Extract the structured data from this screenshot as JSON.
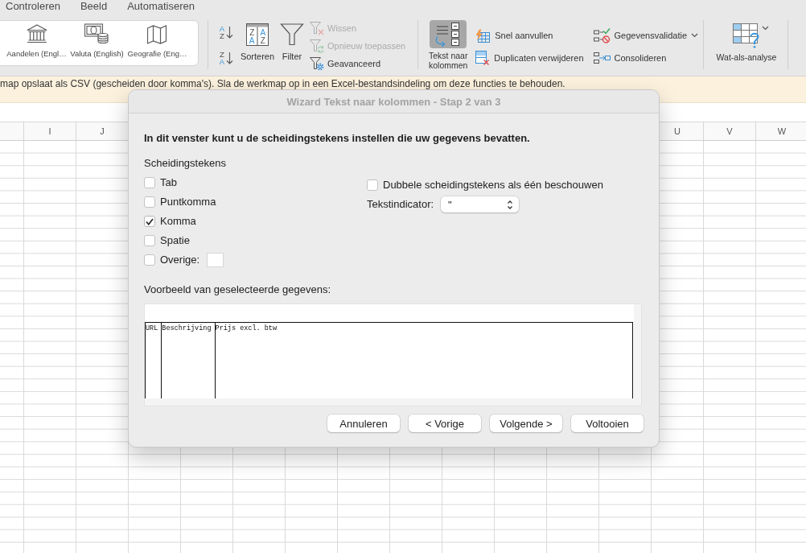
{
  "menu_tabs": [
    "Controleren",
    "Beeld",
    "Automatiseren"
  ],
  "ribbon": {
    "data_types": [
      {
        "kind": "stocks",
        "label": "Aandelen (Engl…"
      },
      {
        "kind": "currencies",
        "label": "Valuta (English)"
      },
      {
        "kind": "geography",
        "label": "Geografie (Eng…"
      }
    ],
    "sort_filter": {
      "quick_sort": [
        {
          "kind": "ascending",
          "letters": [
            "A",
            "Z"
          ]
        },
        {
          "kind": "descending",
          "letters": [
            "Z",
            "A"
          ]
        }
      ],
      "sort": {
        "label": "Sorteren",
        "letters": [
          "Z",
          "A",
          "A",
          "Z"
        ]
      },
      "filter": {
        "label": "Filter"
      },
      "filter_actions": [
        {
          "kind": "clear",
          "label": "Wissen",
          "disabled": true
        },
        {
          "kind": "reapply",
          "label": "Opnieuw toepassen",
          "disabled": true
        },
        {
          "kind": "advanced",
          "label": "Geavanceerd",
          "disabled": false
        }
      ]
    },
    "data_tools": {
      "text_to_columns": {
        "label": "Tekst naar kolommen",
        "selected": true
      },
      "actions": [
        {
          "kind": "flash_fill",
          "label": "Snel aanvullen",
          "dropdown": false
        },
        {
          "kind": "remove_duplicates",
          "label": "Duplicaten verwijderen",
          "dropdown": false
        },
        {
          "kind": "data_validation",
          "label": "Gegevensvalidatie",
          "dropdown": true
        },
        {
          "kind": "consolidate",
          "label": "Consolideren",
          "dropdown": false
        }
      ]
    },
    "what_if": {
      "label": "Wat-als-analyse",
      "dropdown": true
    }
  },
  "notice": {
    "text": "map opslaat als CSV (gescheiden door komma's). Sla de werkmap op in een Excel-bestandsindeling om deze functies te behouden."
  },
  "sheet": {
    "column_headers_left": [
      "I",
      "J"
    ],
    "column_headers_right": [
      "U",
      "V",
      "W"
    ]
  },
  "dialog": {
    "title": "Wizard Tekst naar kolommen - Stap 2 van 3",
    "instruction": "In dit venster kunt u de scheidingstekens instellen die uw gegevens bevatten.",
    "delimiters": {
      "heading": "Scheidingstekens",
      "options": [
        {
          "kind": "plain",
          "label": "Tab",
          "checked": false
        },
        {
          "kind": "plain",
          "label": "Puntkomma",
          "checked": false
        },
        {
          "kind": "plain",
          "label": "Komma",
          "checked": true
        },
        {
          "kind": "plain",
          "label": "Spatie",
          "checked": false
        },
        {
          "kind": "with_field",
          "label": "Overige:",
          "checked": false
        }
      ]
    },
    "treat_consecutive": {
      "label": "Dubbele scheidingstekens als één beschouwen",
      "checked": false
    },
    "text_qualifier": {
      "label": "Tekstindicator:",
      "value": "\""
    },
    "preview": {
      "label": "Voorbeeld van geselecteerde gegevens:",
      "columns": [
        "URL",
        "Beschrijving",
        "Prijs excl. btw"
      ]
    },
    "buttons": [
      "Annuleren",
      "< Vorige",
      "Volgende >",
      "Voltooien"
    ]
  }
}
